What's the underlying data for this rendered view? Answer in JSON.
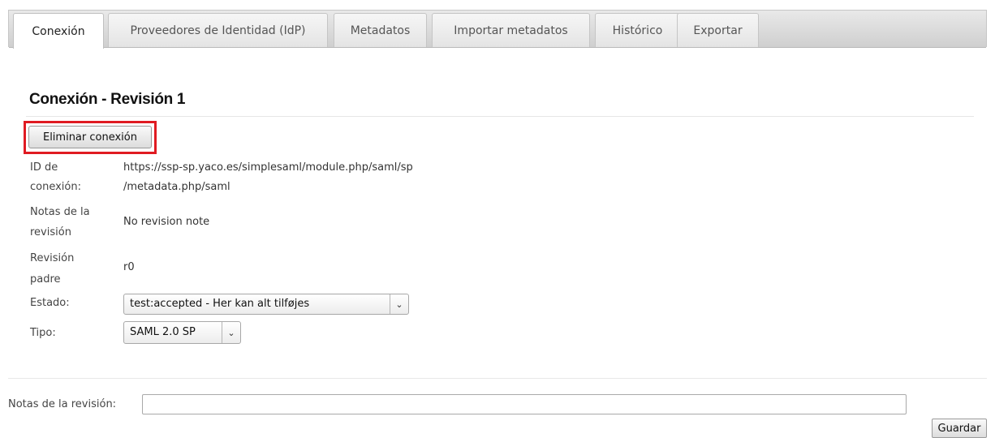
{
  "tabs": [
    {
      "label": "Conexión",
      "active": true
    },
    {
      "label": "Proveedores de Identidad (IdP)",
      "active": false
    },
    {
      "label": "Metadatos",
      "active": false
    },
    {
      "label": "Importar metadatos",
      "active": false
    },
    {
      "label": "Histórico",
      "active": false
    },
    {
      "label": "Exportar",
      "active": false
    }
  ],
  "page": {
    "title": "Conexión - Revisión 1",
    "delete_button": "Eliminar conexión",
    "highlight_color": "#e01b22"
  },
  "fields": {
    "connection_id": {
      "label_line1": "ID de",
      "label_line2": "conexión:",
      "value_line1": "https://ssp-sp.yaco.es/simplesaml/module.php/saml/sp",
      "value_line2": "/metadata.php/saml"
    },
    "revision_notes": {
      "label_line1": "Notas de la",
      "label_line2": "revisión",
      "value": "No revision note"
    },
    "parent_revision": {
      "label_line1": "Revisión",
      "label_line2": "padre",
      "value": "r0"
    },
    "state": {
      "label": "Estado:",
      "value": "test:accepted - Her kan alt tilføjes"
    },
    "type": {
      "label": "Tipo:",
      "value": "SAML 2.0 SP"
    }
  },
  "footer": {
    "notes_label": "Notas de la revisión:",
    "notes_value": "",
    "save_button": "Guardar"
  }
}
